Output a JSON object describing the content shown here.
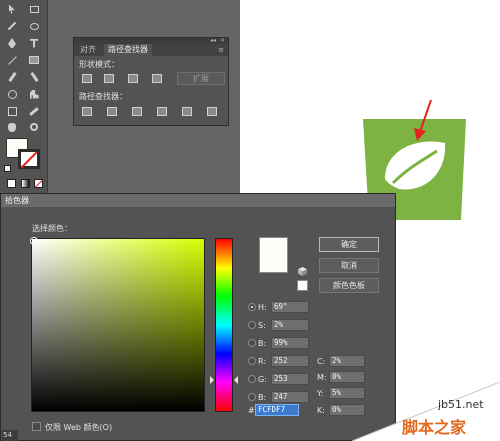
{
  "pathfinder_panel": {
    "tabs": [
      "对齐",
      "路径查找器"
    ],
    "shape_modes_label": "形状模式：",
    "pathfinders_label": "路径查找器：",
    "expand_label": "扩展"
  },
  "color_picker": {
    "title": "拾色器",
    "select_color_label": "选择颜色：",
    "ok_label": "确定",
    "cancel_label": "取消",
    "swatches_label": "颜色色板",
    "hsb": {
      "h_label": "H:",
      "h_value": "69°",
      "s_label": "S:",
      "s_value": "2%",
      "b_label": "B:",
      "b_value": "99%"
    },
    "rgb": {
      "r_label": "R:",
      "r_value": "252",
      "g_label": "G:",
      "g_value": "253",
      "b_label": "B:",
      "b_value": "247"
    },
    "cmyk": {
      "c_label": "C:",
      "c_value": "2%",
      "m_label": "M:",
      "m_value": "0%",
      "y_label": "Y:",
      "y_value": "5%",
      "k_label": "K:",
      "k_value": "0%"
    },
    "hex_label": "#",
    "hex_value": "FCFDF7",
    "web_only_label": "仅限 Web 颜色(O)",
    "selected_color": "#fcfdf7"
  },
  "status_bar": {
    "zoom_partial": "54"
  },
  "logo": {
    "fill": "#7cb342"
  },
  "watermark": {
    "url": "jb51.net",
    "name": "脚本之家"
  }
}
